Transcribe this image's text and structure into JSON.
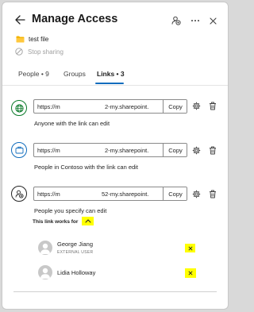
{
  "header": {
    "title": "Manage Access",
    "back_icon": "arrow-left-icon",
    "share_icon": "share-people-icon",
    "more_icon": "more-horizontal-icon",
    "close_icon": "close-icon"
  },
  "file": {
    "name": "test file",
    "icon": "folder-icon"
  },
  "stop_sharing": {
    "label": "Stop sharing",
    "icon": "block-icon"
  },
  "tabs": [
    {
      "label": "People • 9",
      "active": false
    },
    {
      "label": "Groups",
      "active": false
    },
    {
      "label": "Links • 3",
      "active": true
    }
  ],
  "links": [
    {
      "icon": "globe-icon",
      "url_start": "https://m",
      "url_end": "2-my.sharepoint.",
      "copy_label": "Copy",
      "description": "Anyone with the link can edit",
      "accent": "#0b7a2a"
    },
    {
      "icon": "briefcase-icon",
      "url_start": "https://m",
      "url_end": "2-my.sharepoint.",
      "copy_label": "Copy",
      "description": "People in Contoso with the link can edit",
      "accent": "#0f6cbd"
    },
    {
      "icon": "specific-people-icon",
      "url_start": "https://m",
      "url_end": "52-my.sharepoint.",
      "copy_label": "Copy",
      "description": "People you specify can edit",
      "accent": "#242424",
      "works_for_label": "This link works for",
      "people": [
        {
          "name": "George Jiang",
          "subtitle": "EXTERNAL USER"
        },
        {
          "name": "Lidia Holloway",
          "subtitle": ""
        }
      ]
    }
  ],
  "colors": {
    "accent": "#0f6cbd",
    "highlight": "#ffff00"
  }
}
